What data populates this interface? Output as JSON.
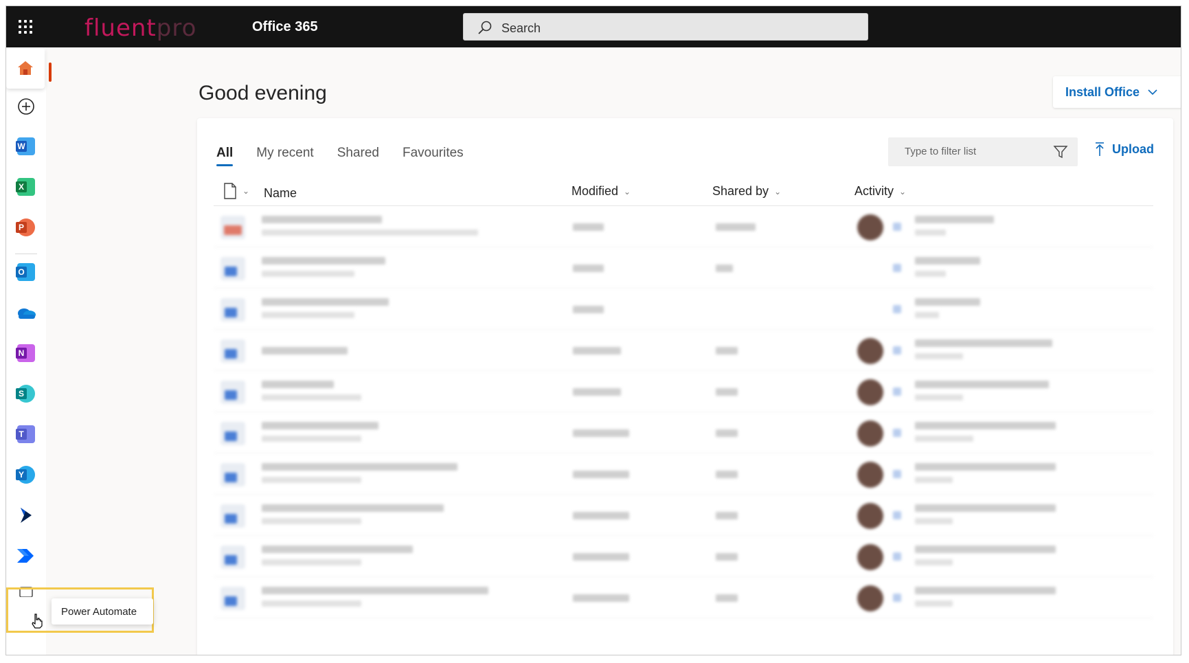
{
  "header": {
    "brand_part1": "fluent",
    "brand_part2": "pro",
    "app_title": "Office 365",
    "search_placeholder": "Search"
  },
  "rail": {
    "items": [
      {
        "name": "home",
        "label": "Home"
      },
      {
        "name": "create",
        "label": "Create"
      },
      {
        "name": "word",
        "letter": "W",
        "color": "#185abd"
      },
      {
        "name": "excel",
        "letter": "X",
        "color": "#107c41"
      },
      {
        "name": "powerpoint",
        "letter": "P",
        "color": "#c43e1c"
      },
      {
        "name": "outlook",
        "letter": "O",
        "color": "#0f6cbd"
      },
      {
        "name": "onedrive",
        "color": "#0f78d4"
      },
      {
        "name": "onenote",
        "letter": "N",
        "color": "#7719aa"
      },
      {
        "name": "sharepoint",
        "letter": "S",
        "color": "#038387"
      },
      {
        "name": "teams",
        "color": "#5059c9"
      },
      {
        "name": "yammer",
        "letter": "Y",
        "color": "#106ebe"
      },
      {
        "name": "dynamics",
        "color": "#002050"
      },
      {
        "name": "power-automate",
        "color": "#0066ff"
      }
    ],
    "tooltip": "Power Automate"
  },
  "main": {
    "greeting": "Good evening",
    "install_button": "Install Office",
    "tabs": [
      "All",
      "My recent",
      "Shared",
      "Favourites"
    ],
    "filter_placeholder": "Type to filter list",
    "upload_label": "Upload",
    "columns": {
      "name": "Name",
      "modified": "Modified",
      "shared_by": "Shared by",
      "activity": "Activity"
    }
  },
  "colors": {
    "accent": "#0f6cbd",
    "topbar": "#141414",
    "brand": "#c2185b",
    "highlight": "#f2c94c",
    "active_indicator": "#d83b01"
  }
}
